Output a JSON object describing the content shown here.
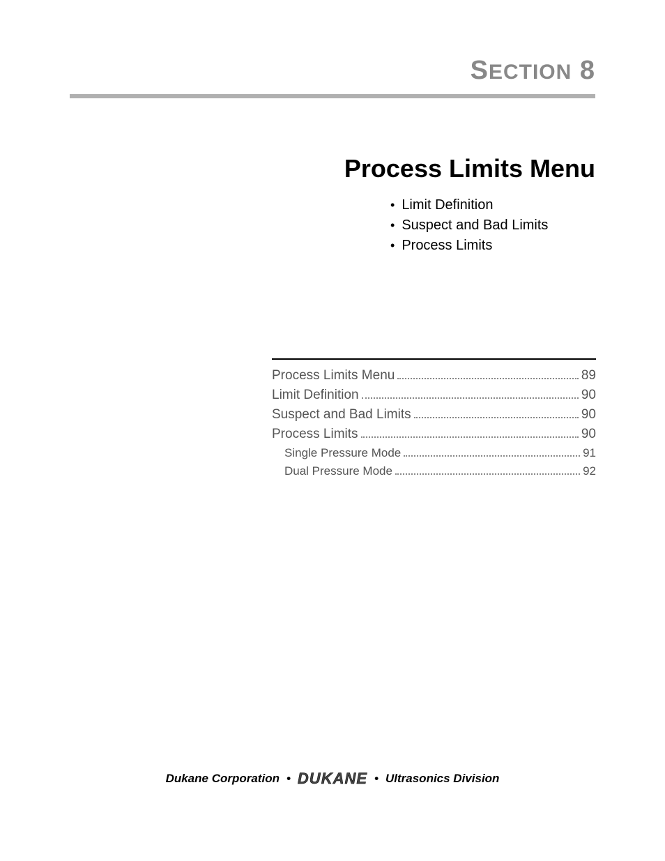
{
  "header": {
    "section_prefix": "S",
    "section_rest": "ECTION",
    "section_number": "8"
  },
  "title": "Process Limits Menu",
  "bullets": [
    "Limit Definition",
    "Suspect and Bad Limits",
    "Process Limits"
  ],
  "toc": [
    {
      "title": "Process Limits Menu",
      "page": "89",
      "level": 0
    },
    {
      "title": "Limit Definition",
      "page": "90",
      "level": 0
    },
    {
      "title": "Suspect and Bad Limits",
      "page": "90",
      "level": 0
    },
    {
      "title": "Process Limits",
      "page": "90",
      "level": 0
    },
    {
      "title": "Single Pressure Mode",
      "page": "91",
      "level": 1
    },
    {
      "title": "Dual Pressure Mode",
      "page": "92",
      "level": 1
    }
  ],
  "footer": {
    "left": "Dukane Corporation",
    "separator": "•",
    "logo": "DUKANE",
    "right": "Ultrasonics Division"
  }
}
